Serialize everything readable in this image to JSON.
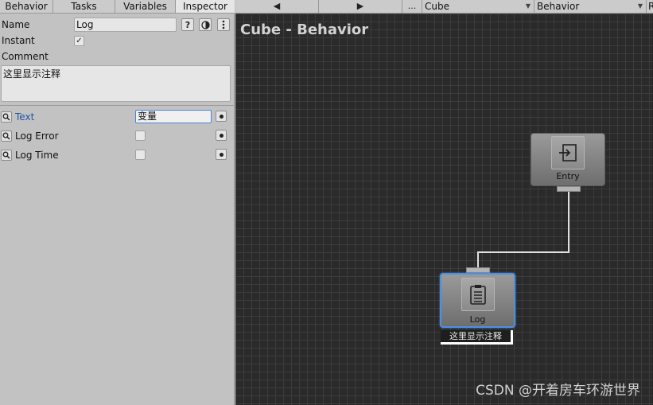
{
  "tabs": [
    "Behavior",
    "Tasks",
    "Variables",
    "Inspector"
  ],
  "inspector": {
    "name_label": "Name",
    "name_value": "Log",
    "instant_label": "Instant",
    "instant_checked": "✓",
    "comment_label": "Comment",
    "comment_value": "这里显示注释",
    "fields": [
      {
        "label": "Text",
        "value": "变量"
      },
      {
        "label": "Log Error",
        "value": ""
      },
      {
        "label": "Log Time",
        "value": ""
      }
    ]
  },
  "toolbar": {
    "prev": "◀",
    "next": "▶",
    "more": "...",
    "object": "Cube",
    "behavior": "Behavior",
    "extra": "Re"
  },
  "graph": {
    "title": "Cube - Behavior",
    "entry_label": "Entry",
    "log_label": "Log",
    "log_comment": "这里显示注释",
    "watermark": "CSDN @开着房车环游世界"
  },
  "colors": {
    "accent": "#4a86d4",
    "link_text": "#1f56a8",
    "canvas_bg": "#2a2a2a"
  }
}
